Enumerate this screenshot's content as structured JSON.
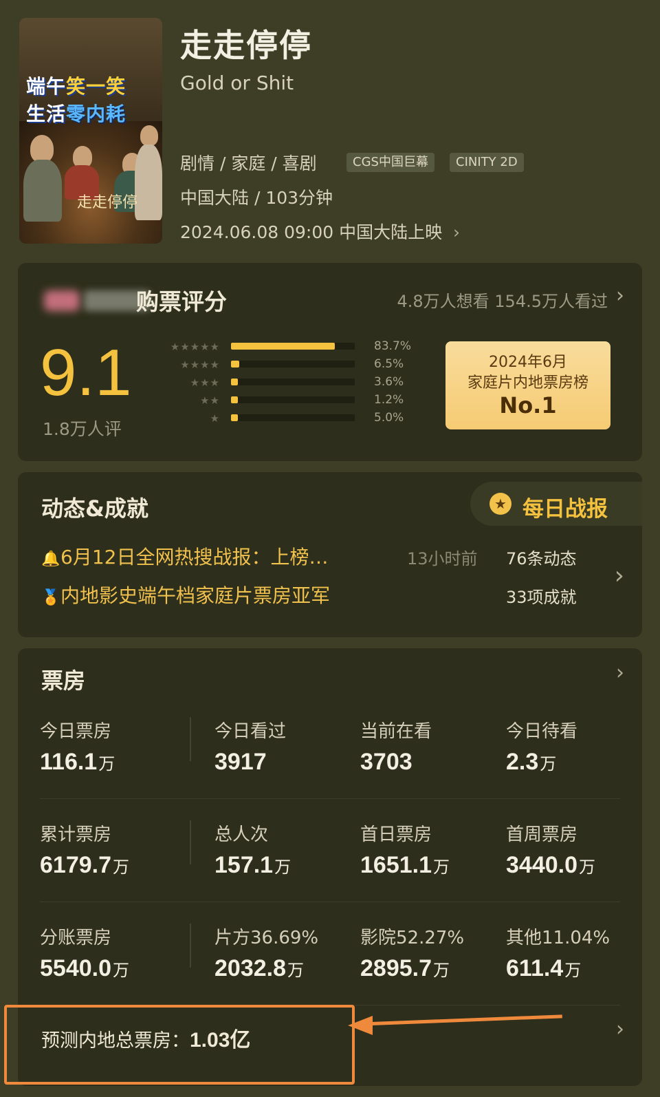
{
  "movie": {
    "title": "走走停停",
    "english_title": "Gold or Shit",
    "genres": "剧情 / 家庭 / 喜剧",
    "tags": [
      "CGS中国巨幕",
      "CINITY 2D"
    ],
    "region_duration": "中国大陆 / 103分钟",
    "release": "2024.06.08 09:00 中国大陆上映",
    "poster": {
      "line1_a": "端午",
      "line1_b": "笑一笑",
      "line2_a": "生活",
      "line2_b": "零内耗",
      "title": "走走停停"
    }
  },
  "rating": {
    "title": "购票评分",
    "stats": "4.8万人想看 154.5万人看过",
    "score": "9.1",
    "count": "1.8万人评",
    "distribution": [
      {
        "stars": "★★★★★",
        "pct_label": "83.7%",
        "pct": 83.7
      },
      {
        "stars": "★★★★",
        "pct_label": "6.5%",
        "pct": 6.5
      },
      {
        "stars": "★★★",
        "pct_label": "3.6%",
        "pct": 3.6
      },
      {
        "stars": "★★",
        "pct_label": "1.2%",
        "pct": 1.2
      },
      {
        "stars": "★",
        "pct_label": "5.0%",
        "pct": 5.0
      }
    ],
    "award": {
      "line1": "2024年6月",
      "line2": "家庭片内地票房榜",
      "rank": "No.1"
    }
  },
  "news": {
    "title": "动态&成就",
    "daily_button": "每日战报",
    "item1": "6月12日全网热搜战报：上榜…",
    "item1_time": "13小时前",
    "item1_count": "76条动态",
    "item2": "内地影史端午档家庭片票房亚军",
    "item2_count": "33项成就"
  },
  "box_office": {
    "title": "票房",
    "rows": [
      [
        {
          "label": "今日票房",
          "value": "116.1",
          "unit": "万"
        },
        {
          "label": "今日看过",
          "value": "3917",
          "unit": ""
        },
        {
          "label": "当前在看",
          "value": "3703",
          "unit": ""
        },
        {
          "label": "今日待看",
          "value": "2.3",
          "unit": "万"
        }
      ],
      [
        {
          "label": "累计票房",
          "value": "6179.7",
          "unit": "万"
        },
        {
          "label": "总人次",
          "value": "157.1",
          "unit": "万"
        },
        {
          "label": "首日票房",
          "value": "1651.1",
          "unit": "万"
        },
        {
          "label": "首周票房",
          "value": "3440.0",
          "unit": "万"
        }
      ],
      [
        {
          "label": "分账票房",
          "value": "5540.0",
          "unit": "万"
        },
        {
          "label": "片方36.69%",
          "value": "2032.8",
          "unit": "万"
        },
        {
          "label": "影院52.27%",
          "value": "2895.7",
          "unit": "万"
        },
        {
          "label": "其他11.04%",
          "value": "611.4",
          "unit": "万"
        }
      ]
    ],
    "forecast_label": "预测内地总票房：",
    "forecast_value": "1.03亿"
  },
  "colors": {
    "accent": "#f5c23f",
    "annotation": "#ef8a3c",
    "background": "#3d3e25",
    "card": "#2d2e1b"
  }
}
